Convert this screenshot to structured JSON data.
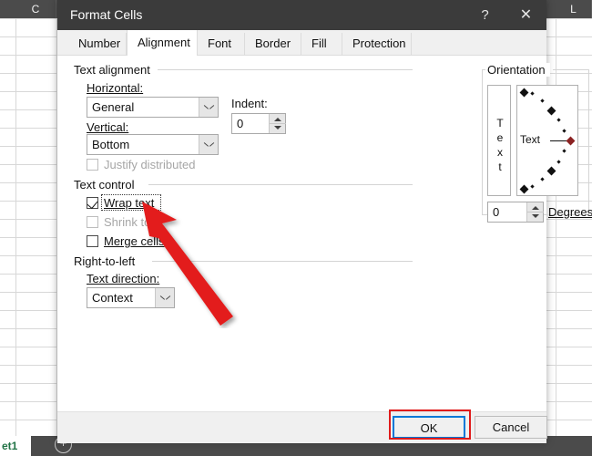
{
  "background": {
    "app": "excel",
    "column_headers": [
      "C",
      "L"
    ],
    "sheet_tab_label": "et1",
    "add_sheet_icon": "plus-circle-icon"
  },
  "dialog": {
    "title": "Format Cells",
    "help_icon": "question-mark-icon",
    "close_icon": "close-icon",
    "tabs": [
      {
        "label": "Number",
        "active": false
      },
      {
        "label": "Alignment",
        "active": true
      },
      {
        "label": "Font",
        "active": false
      },
      {
        "label": "Border",
        "active": false
      },
      {
        "label": "Fill",
        "active": false
      },
      {
        "label": "Protection",
        "active": false
      }
    ],
    "text_alignment": {
      "group_label": "Text alignment",
      "horizontal_label": "Horizontal:",
      "horizontal_value": "General",
      "vertical_label": "Vertical:",
      "vertical_value": "Bottom",
      "indent_label": "Indent:",
      "indent_value": "0",
      "justify_distributed_label": "Justify distributed",
      "justify_distributed_checked": false,
      "justify_distributed_enabled": false
    },
    "text_control": {
      "group_label": "Text control",
      "wrap_text_label": "Wrap text",
      "wrap_text_checked": true,
      "shrink_to_fit_label": "Shrink to fit",
      "shrink_to_fit_checked": false,
      "shrink_to_fit_enabled": false,
      "merge_cells_label": "Merge cells",
      "merge_cells_checked": false
    },
    "right_to_left": {
      "group_label": "Right-to-left",
      "text_direction_label": "Text direction:",
      "text_direction_value": "Context"
    },
    "orientation": {
      "group_label": "Orientation",
      "vertical_text_letters": [
        "T",
        "e",
        "x",
        "t"
      ],
      "dial_text_label": "Text",
      "degrees_value": "0",
      "degrees_label": "Degrees"
    },
    "buttons": {
      "ok_label": "OK",
      "cancel_label": "Cancel"
    }
  },
  "annotations": {
    "arrow_color": "#e31b1b",
    "highlight_color": "#e01b1b",
    "focus_color": "#0078d7"
  }
}
